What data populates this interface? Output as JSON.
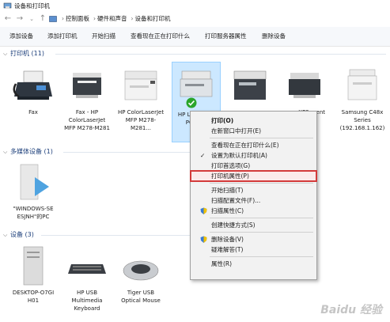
{
  "window": {
    "title": "设备和打印机"
  },
  "nav": {
    "breadcrumb": [
      "控制面板",
      "硬件和声音",
      "设备和打印机"
    ]
  },
  "toolbar": {
    "items": [
      "添加设备",
      "添加打印机",
      "开始扫描",
      "查看现在正在打印什么",
      "打印服务器属性",
      "删除设备"
    ]
  },
  "sections": {
    "printers": "打印机 (11)",
    "multimedia": "多媒体设备 (1)",
    "devices": "设备 (3)"
  },
  "printers": [
    {
      "label": "Fax"
    },
    {
      "label": "Fax - HP ColorLaserJet MFP M278-M281"
    },
    {
      "label": "HP ColorLaserJet MFP M278-M281..."
    },
    {
      "label": "HP L... M12... PCLm..."
    },
    {
      "label": ""
    },
    {
      "label": "... XPS ...ent"
    },
    {
      "label": "Samsung C48x Series (192.168.1.162)"
    }
  ],
  "multimedia": [
    {
      "label": "\"WINDOWS-SE ESJNH\"的PC"
    }
  ],
  "devices": [
    {
      "label": "DESKTOP-O7GI H01"
    },
    {
      "label": "HP USB Multimedia Keyboard"
    },
    {
      "label": "Tiger USB Optical Mouse"
    }
  ],
  "context_menu": {
    "items": [
      {
        "label": "打印(O)",
        "bold": true
      },
      {
        "label": "在新窗口中打开(E)"
      },
      {
        "sep": true
      },
      {
        "label": "查看现在正在打印什么(E)"
      },
      {
        "label": "设置为默认打印机(A)",
        "icon": "checkmark-icon"
      },
      {
        "label": "打印首选项(G)"
      },
      {
        "label": "打印机属性(P)",
        "highlight": true
      },
      {
        "sep": true
      },
      {
        "label": "开始扫描(T)"
      },
      {
        "label": "扫描配置文件(F)..."
      },
      {
        "label": "扫描属性(C)",
        "icon": "shield-icon"
      },
      {
        "sep": true
      },
      {
        "label": "创建快捷方式(S)"
      },
      {
        "sep": true
      },
      {
        "label": "删除设备(V)",
        "icon": "shield-icon"
      },
      {
        "label": "疑难解答(T)"
      },
      {
        "sep": true
      },
      {
        "label": "属性(R)"
      }
    ]
  },
  "watermark": "Baidu 经验",
  "colors": {
    "accent": "#1b3e7a",
    "selection": "#cce8ff",
    "highlight_border": "#d33a3a"
  }
}
